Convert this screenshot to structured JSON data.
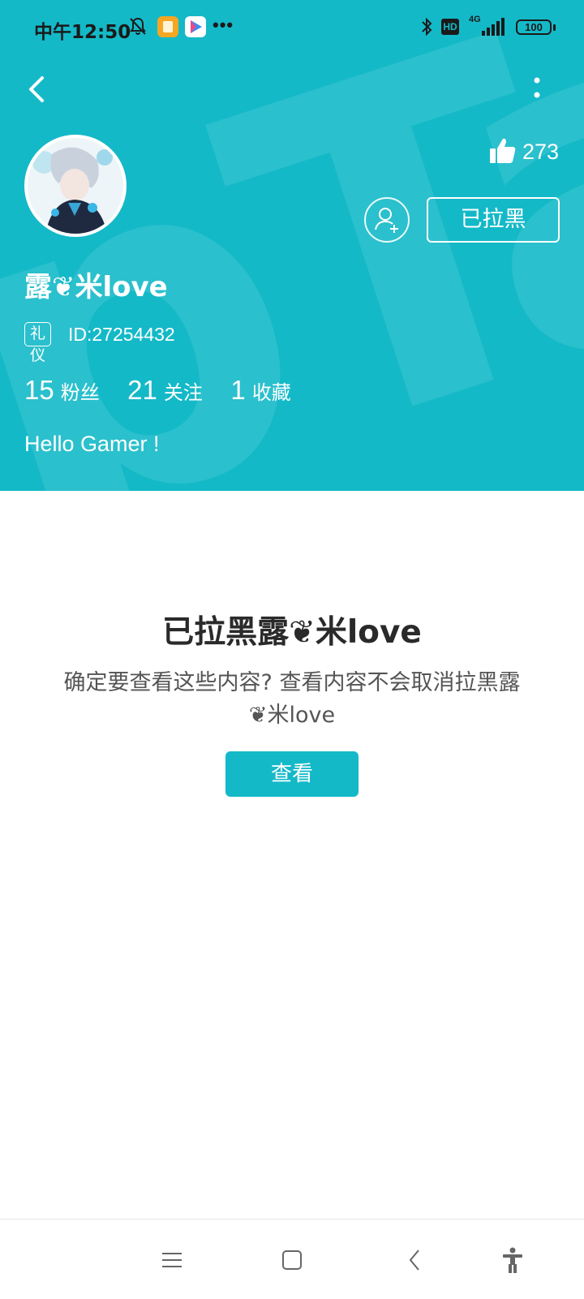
{
  "status_bar": {
    "time": "中午12:50",
    "network": "4G",
    "hd_label": "HD",
    "battery": "100"
  },
  "profile": {
    "likes_count": "273",
    "blocked_button_label": "已拉黑",
    "username": "露❦米love",
    "badge": "礼仪",
    "user_id": "ID:27254432",
    "stats": [
      {
        "value": "15",
        "label": "粉丝"
      },
      {
        "value": "21",
        "label": "关注"
      },
      {
        "value": "1",
        "label": "收藏"
      }
    ],
    "bio": "Hello Gamer !"
  },
  "blocked_notice": {
    "title": "已拉黑露❦米love",
    "description": "确定要查看这些内容? 查看内容不会取消拉黑露❦米love",
    "view_button_label": "查看"
  },
  "colors": {
    "accent": "#14b9c8",
    "text_dark": "#2a2a2a",
    "text_muted": "#555555"
  },
  "icons": {
    "back": "chevron-left-icon",
    "more": "vertical-dots-icon",
    "like": "thumbs-up-icon",
    "follow": "add-user-icon",
    "nav_menu": "menu-icon",
    "nav_home": "square-icon",
    "nav_back": "back-icon",
    "nav_accessibility": "accessibility-icon"
  }
}
